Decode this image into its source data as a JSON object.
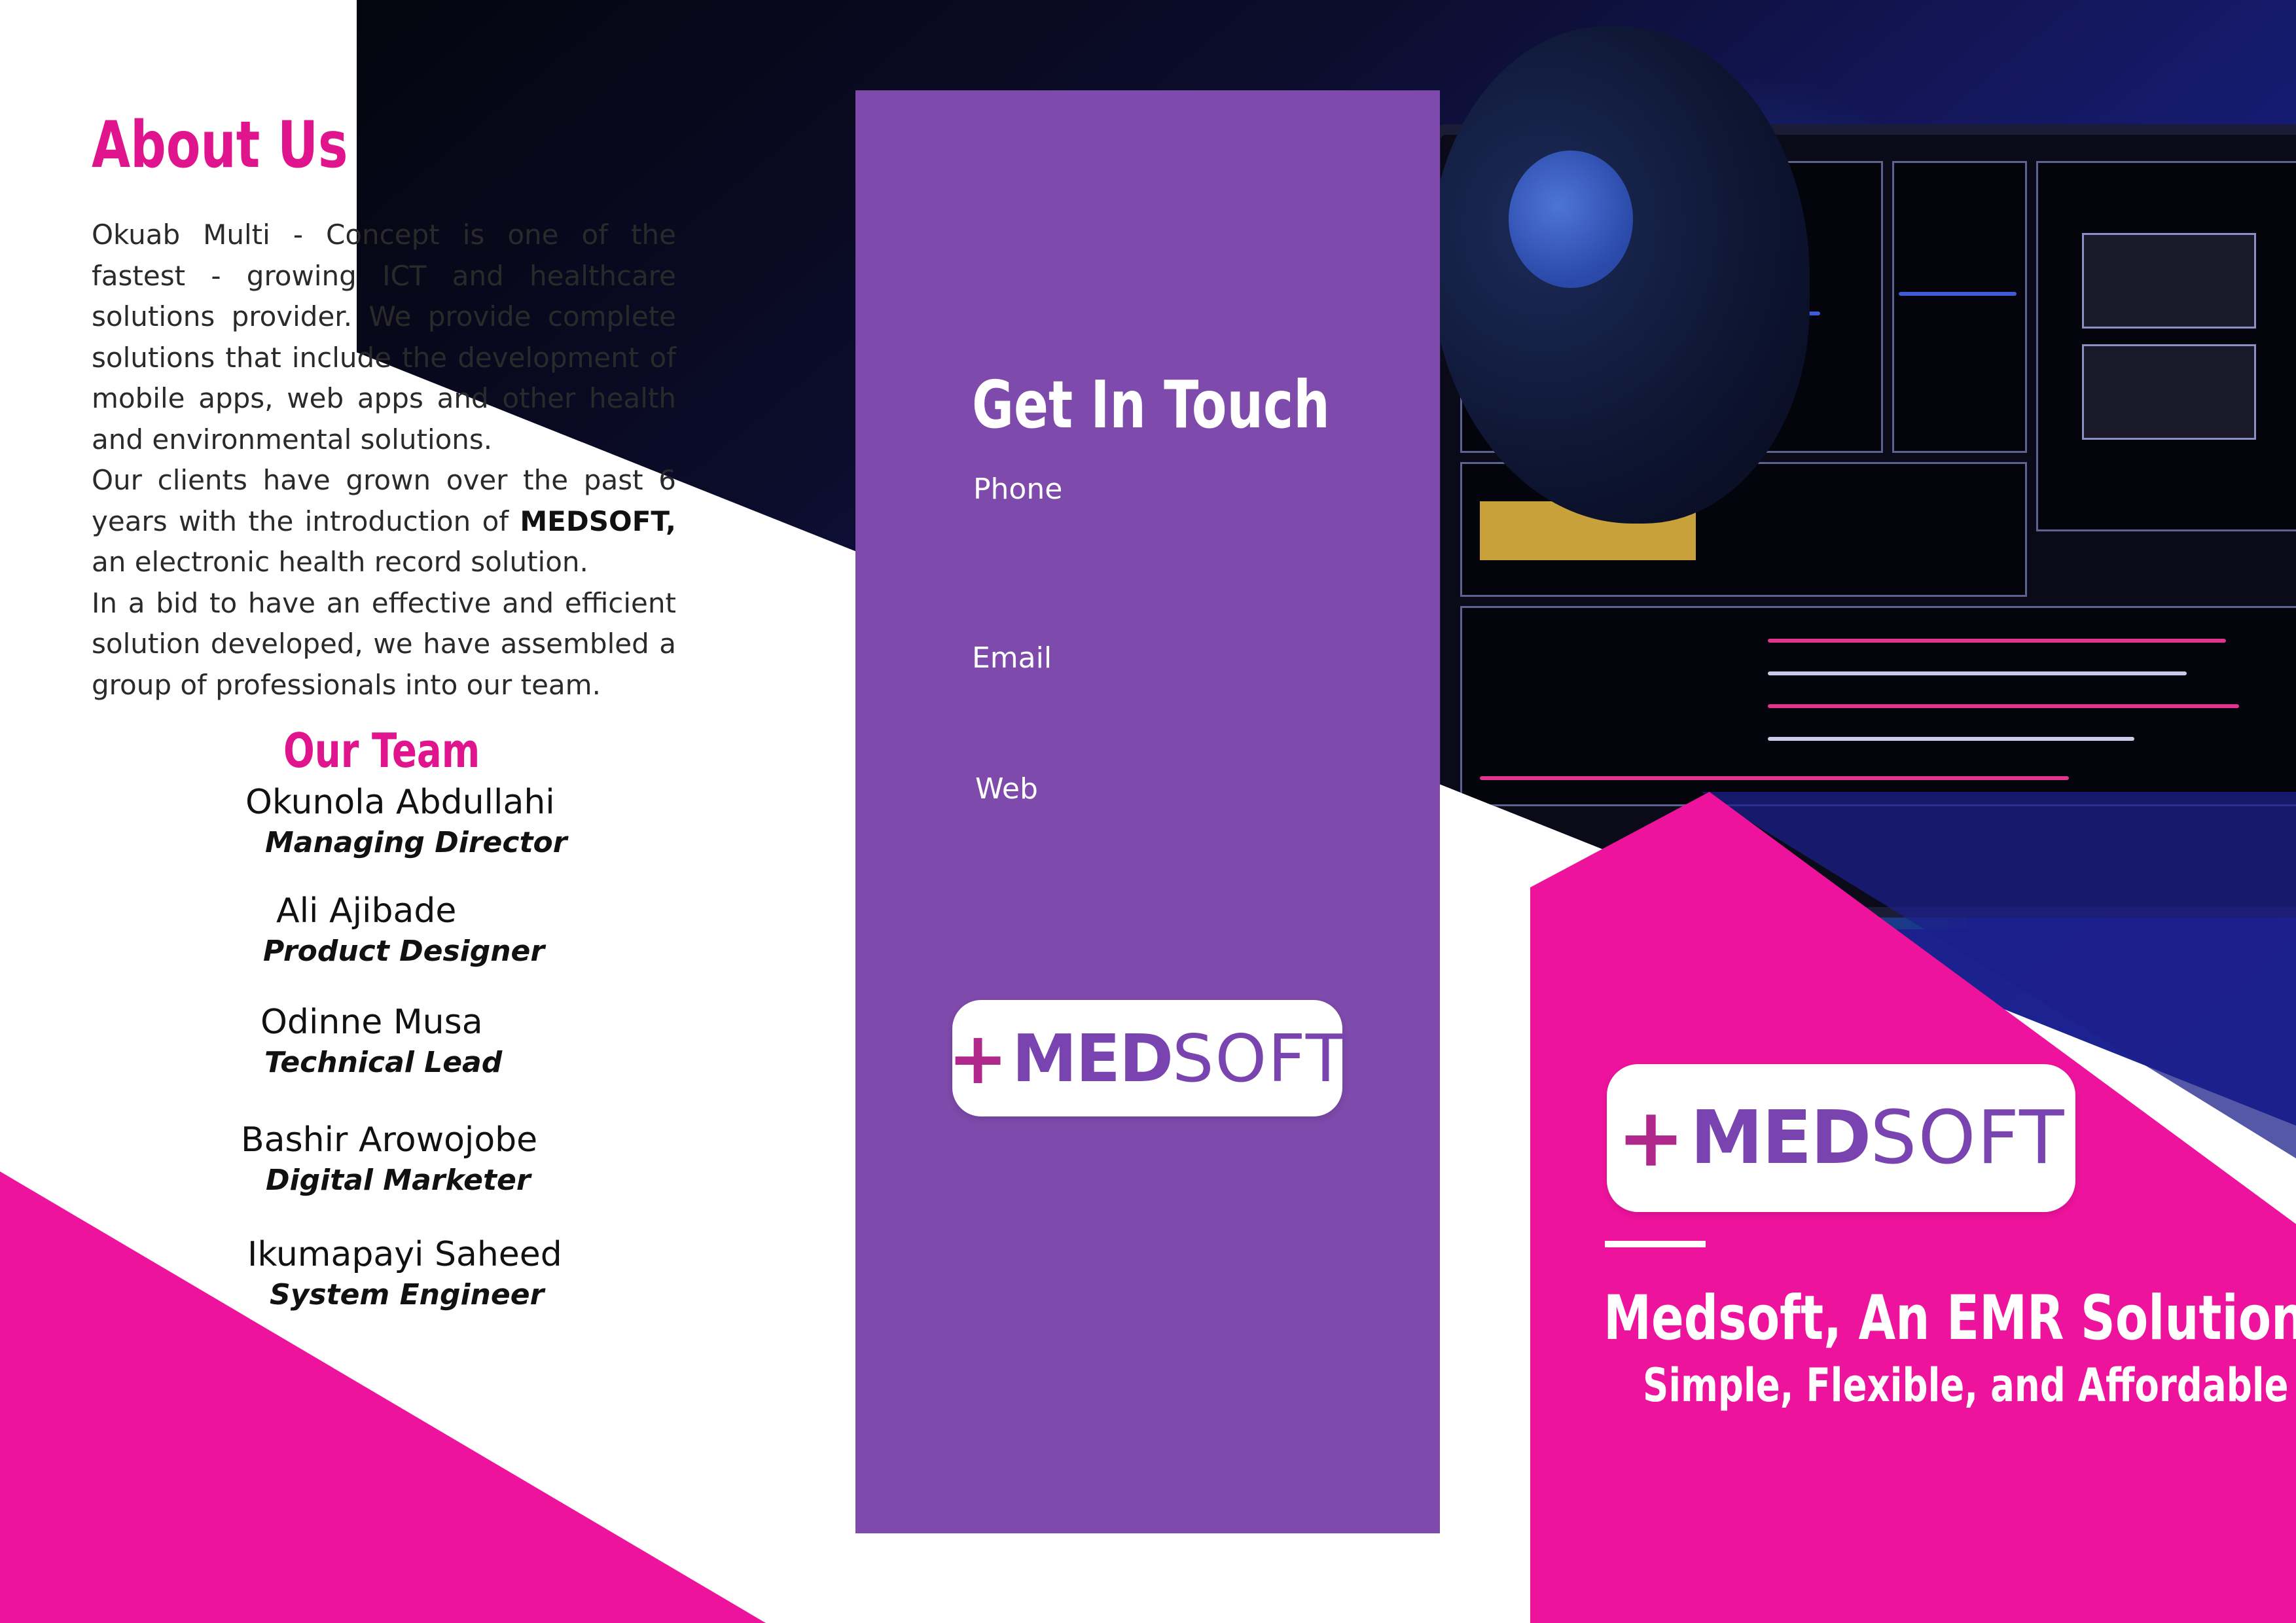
{
  "about": {
    "title": "About Us",
    "p1": "Okuab Multi - Concept is one of the fastest - growing ICT and healthcare solutions provider. We provide complete solutions that include the development of mobile apps, web apps and other health and environmental solutions.",
    "p2_start": "Our clients have grown over the past 6 years with the introduction of ",
    "p2_bold": "MEDSOFT,",
    "p2_end": " an electronic health record solution.",
    "p3": "In a bid to have an effective and efficient solution developed, we have assembled a group of  professionals into our team."
  },
  "team": {
    "title": "Our Team",
    "members": [
      {
        "name": "Okunola Abdullahi",
        "role": "Managing Director"
      },
      {
        "name": "Ali Ajibade",
        "role": "Product Designer"
      },
      {
        "name": "Odinne Musa",
        "role": "Technical Lead"
      },
      {
        "name": "Bashir Arowojobe",
        "role": "Digital Marketer"
      },
      {
        "name": "Ikumapayi Saheed",
        "role": "System Engineer"
      }
    ]
  },
  "contact": {
    "title": "Get In Touch",
    "phone_label": "Phone",
    "email_label": "Email",
    "web_label": "Web"
  },
  "logo": {
    "plus": "+",
    "med": "MED",
    "soft": "SOFT"
  },
  "cover": {
    "tagline": "Medsoft, An EMR Solution",
    "subtagline": "Simple, Flexible, and Affordable"
  },
  "colors": {
    "pink": "#ee139c",
    "purple_panel": "#7e4aab",
    "heading_pink": "#e0158e",
    "logo_purple": "#7a44b0",
    "logo_plus": "#b1288c"
  }
}
